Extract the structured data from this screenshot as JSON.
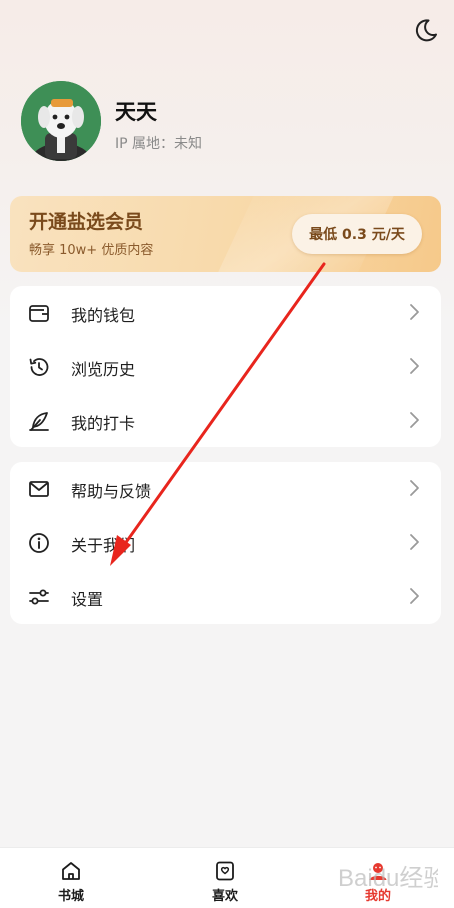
{
  "header": {
    "night_mode_icon": "moon-icon"
  },
  "profile": {
    "name": "天天",
    "ip_label": "IP 属地：",
    "ip_value": "未知"
  },
  "vip": {
    "title": "开通盐选会员",
    "subtitle": "畅享 10w+ 优质内容",
    "price_button": "最低 0.3 元/天"
  },
  "menu_group_1": [
    {
      "label": "我的钱包",
      "icon": "wallet-icon"
    },
    {
      "label": "浏览历史",
      "icon": "history-icon"
    },
    {
      "label": "我的打卡",
      "icon": "feather-icon"
    }
  ],
  "menu_group_2": [
    {
      "label": "帮助与反馈",
      "icon": "mail-icon"
    },
    {
      "label": "关于我们",
      "icon": "info-icon"
    },
    {
      "label": "设置",
      "icon": "settings-sliders-icon"
    }
  ],
  "tabbar": [
    {
      "label": "书城",
      "icon": "home-icon"
    },
    {
      "label": "喜欢",
      "icon": "heart-box-icon"
    },
    {
      "label": "我的",
      "icon": "profile-icon",
      "active": true
    }
  ],
  "colors": {
    "accent": "#e6392f",
    "vip_text": "#7a4a1c",
    "annotation_arrow": "#e8251d"
  }
}
